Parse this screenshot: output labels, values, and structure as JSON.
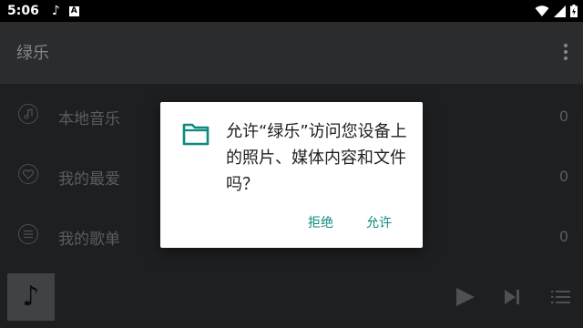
{
  "status_bar": {
    "time": "5:06",
    "notification_note": "♪",
    "notification_a": "A"
  },
  "app_bar": {
    "title": "绿乐"
  },
  "list": {
    "items": [
      {
        "label": "本地音乐",
        "count": "0",
        "icon": "music-note-icon"
      },
      {
        "label": "我的最爱",
        "count": "0",
        "icon": "heart-icon"
      },
      {
        "label": "我的歌单",
        "count": "0",
        "icon": "playlist-icon"
      }
    ]
  },
  "player": {
    "art_glyph": "♪"
  },
  "dialog": {
    "message": "允许“绿乐”访问您设备上的照片、媒体内容和文件吗？",
    "deny_label": "拒绝",
    "allow_label": "允许",
    "accent_color": "#0e8a7e"
  }
}
